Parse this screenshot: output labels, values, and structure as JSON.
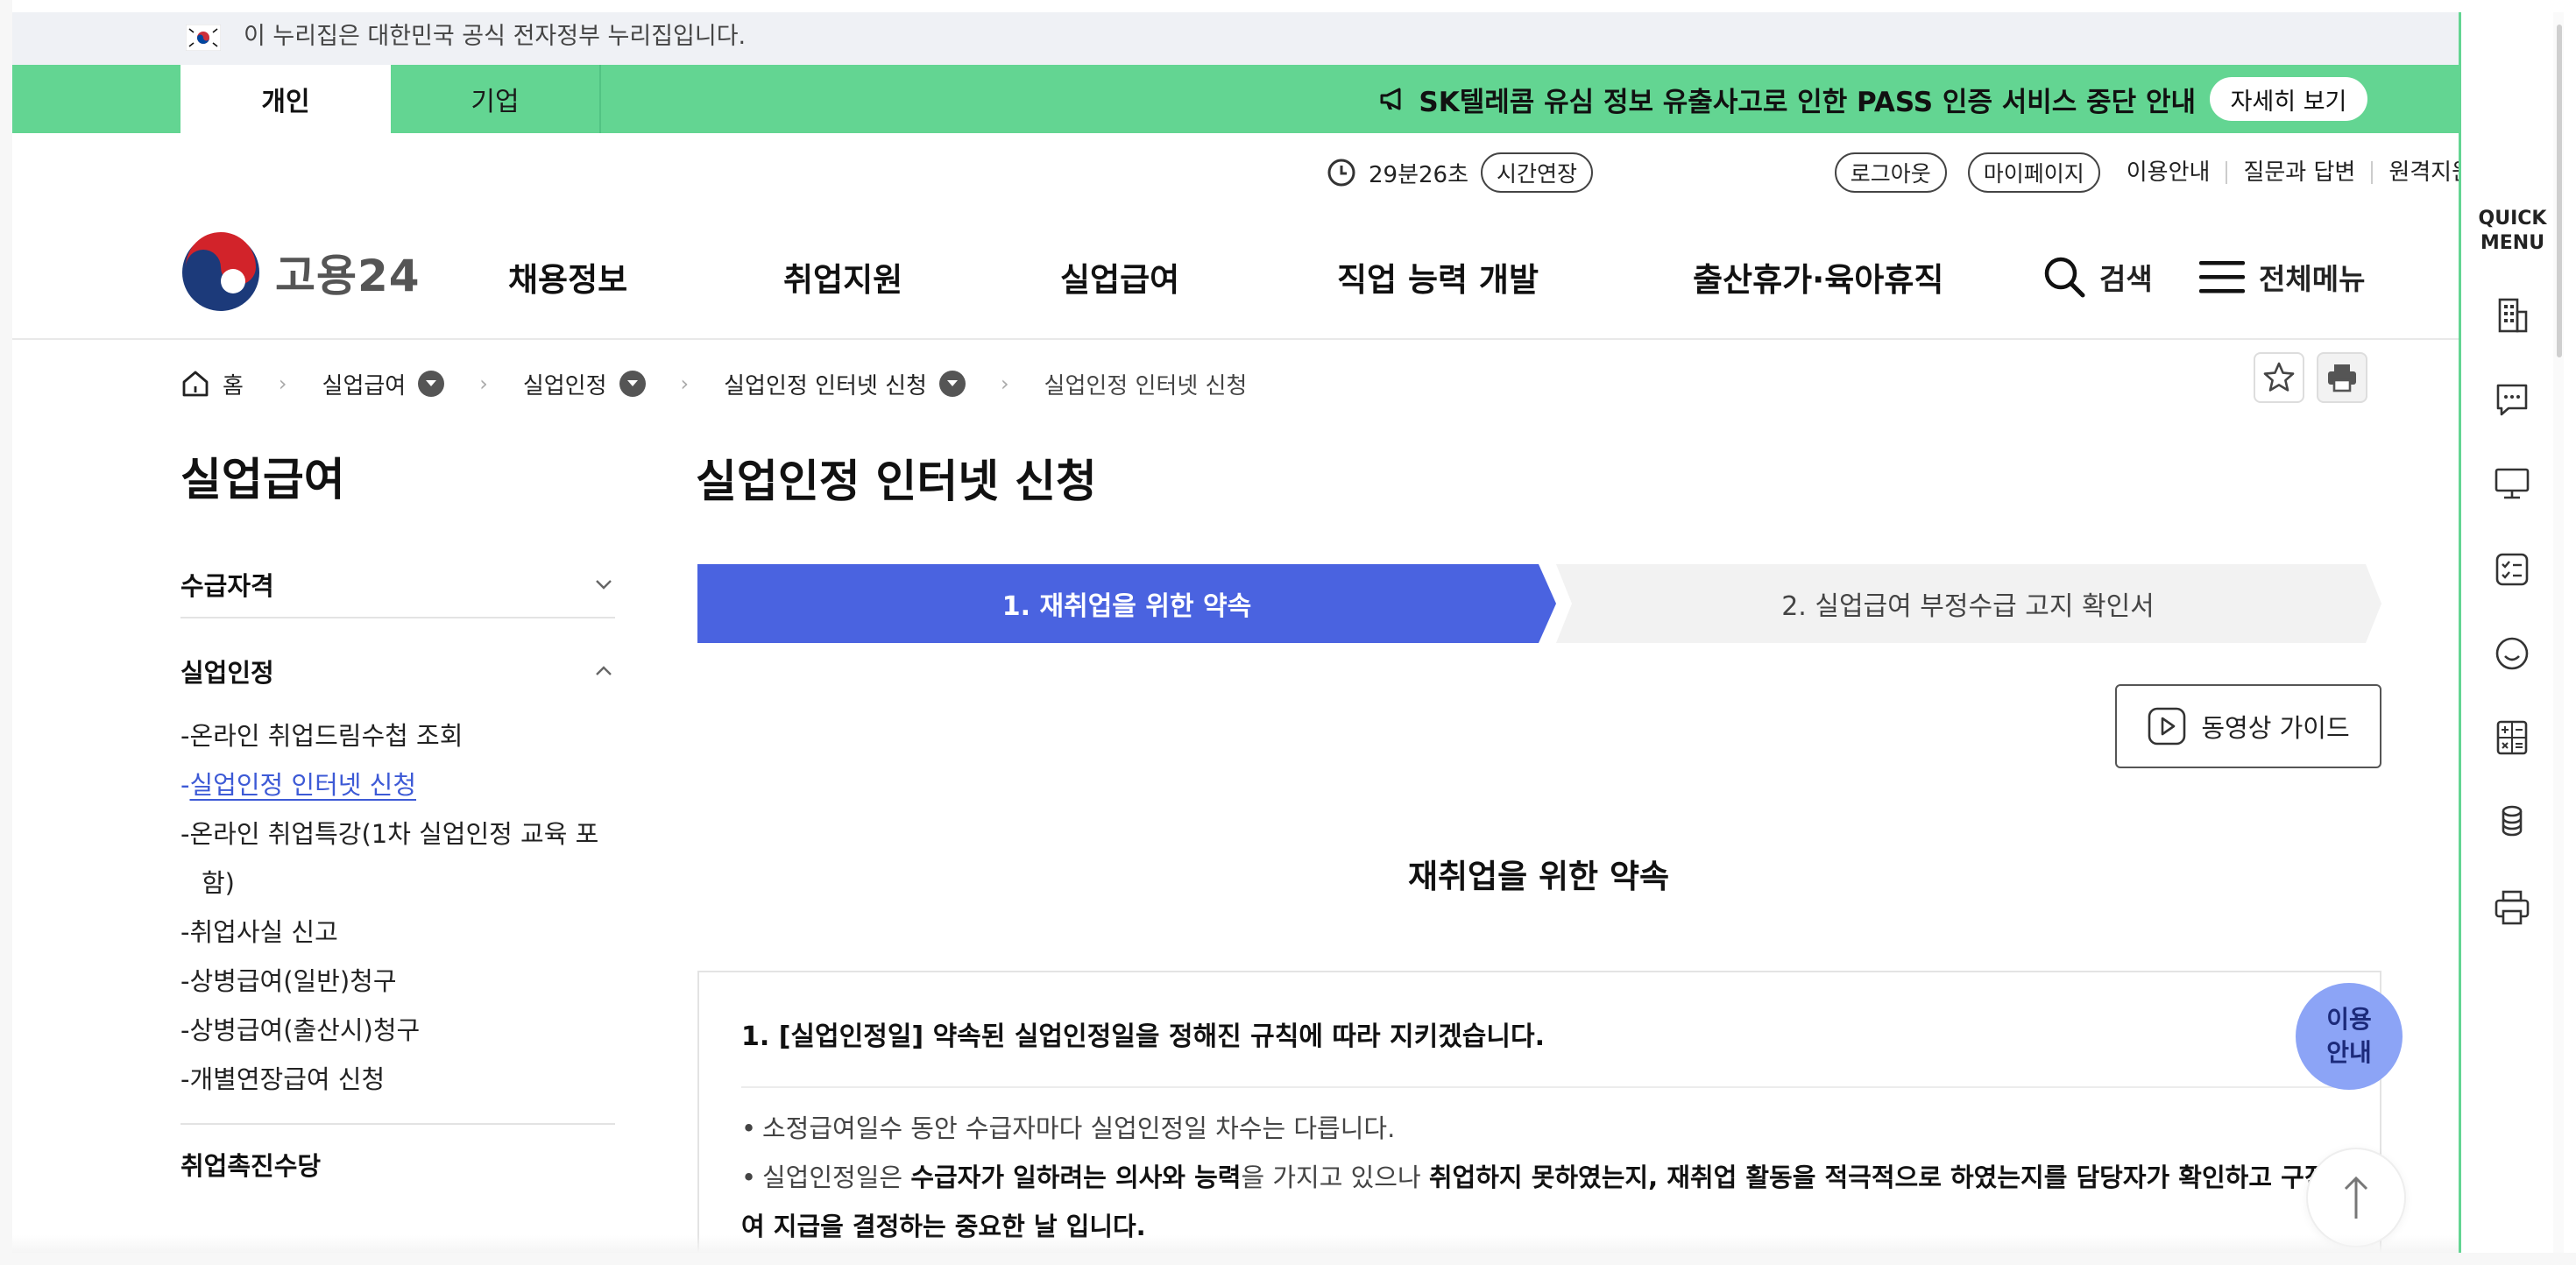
{
  "gov_banner": {
    "text": "이 누리집은 대한민국 공식 전자정부 누리집입니다."
  },
  "top_tabs": {
    "personal": "개인",
    "corporate": "기업"
  },
  "notice": {
    "text": "SK텔레콤 유심 정보 유출사고로 인한 PASS 인증 서비스 중단 안내",
    "button": "자세히 보기"
  },
  "utility": {
    "timer": "29분26초",
    "extend": "시간연장",
    "logout": "로그아웃",
    "mypage": "마이페이지",
    "links": [
      "이용안내",
      "질문과 답변",
      "원격지원"
    ]
  },
  "logo": {
    "text": "고용24"
  },
  "gnb": {
    "items": [
      "채용정보",
      "취업지원",
      "실업급여",
      "직업 능력 개발",
      "출산휴가·육아휴직"
    ],
    "search": "검색",
    "all_menu": "전체메뉴"
  },
  "breadcrumb": {
    "home": "홈",
    "items": [
      "실업급여",
      "실업인정",
      "실업인정 인터넷 신청",
      "실업인정 인터넷 신청"
    ]
  },
  "lnb": {
    "title": "실업급여",
    "sections": [
      {
        "label": "수급자격",
        "expanded": false
      },
      {
        "label": "실업인정",
        "expanded": true
      }
    ],
    "items": [
      "온라인 취업드림수첩 조회",
      "실업인정 인터넷 신청",
      "온라인 취업특강(1차 실업인정 교육 포함)",
      "취업사실 신고",
      "상병급여(일반)청구",
      "상병급여(출산시)청구",
      "개별연장급여 신청"
    ],
    "active_index": 1,
    "next_section": "취업촉진수당"
  },
  "main": {
    "title": "실업인정 인터넷 신청",
    "steps": [
      "1. 재취업을 위한 약속",
      "2. 실업급여 부정수급 고지 확인서"
    ],
    "active_step": 0,
    "video_guide": "동영상 가이드",
    "section_title": "재취업을 위한 약속",
    "card": {
      "heading": "1. [실업인정일] 약속된 실업인정일을 정해진 규칙에 따라 지키겠습니다.",
      "bullet1": "소정급여일수 동안 수급자마다 실업인정일 차수는 다릅니다.",
      "bullet2": {
        "t1": "실업인정일은 ",
        "b1": "수급자가 일하려는 의사와 능력",
        "t2": "을 가지고 있으나 ",
        "b2": "취업하지 못하였는지, 재취업 활동을 적극적으로 하였는지를 담당자가 확인하고 구직급여 지급을 결정하는 중요한 날 입니다."
      }
    }
  },
  "floating": {
    "info_line1": "이용",
    "info_line2": "안내"
  },
  "quick_menu": {
    "title_line1": "QUICK",
    "title_line2": "MENU",
    "icons": [
      "building-icon",
      "chat-icon",
      "monitor-icon",
      "checklist-icon",
      "smile-icon",
      "calculator-icon",
      "coins-icon",
      "print-icon"
    ]
  },
  "colors": {
    "green": "#63d592",
    "accent_blue": "#4a63e0",
    "link_blue": "#3d5ad6",
    "info_fab": "#8ca4f6"
  }
}
